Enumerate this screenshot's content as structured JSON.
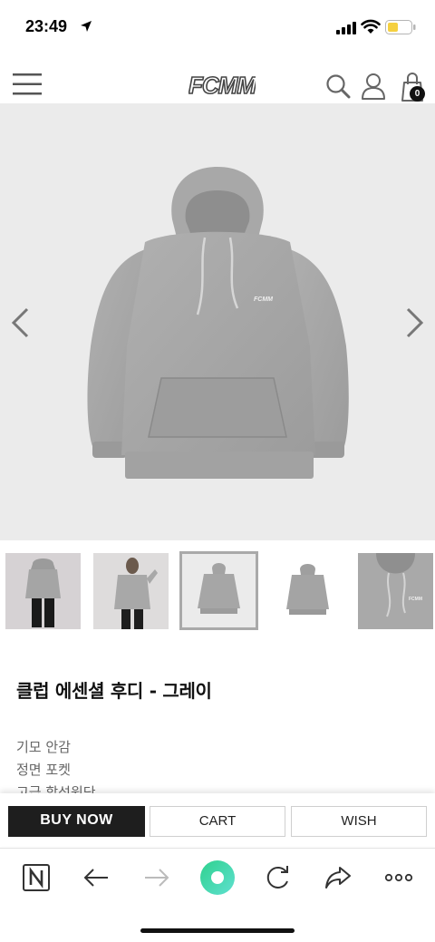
{
  "status": {
    "time": "23:49"
  },
  "header": {
    "logo": "FCMM",
    "cart_count": "0"
  },
  "product": {
    "thumbnail_logo": "FCMM",
    "title": "클럽 에센셜 후디 - 그레이",
    "description": [
      "기모 안감",
      "정면 포켓",
      "고급 합성원단"
    ]
  },
  "actions": {
    "buy_now": "BUY NOW",
    "cart": "CART",
    "wish": "WISH"
  },
  "colors": {
    "hoodie": "#a6a6a6",
    "image_bg": "#ebebeb",
    "buy_button": "#1e1e1e",
    "browser_accent": "#33d6a0"
  }
}
